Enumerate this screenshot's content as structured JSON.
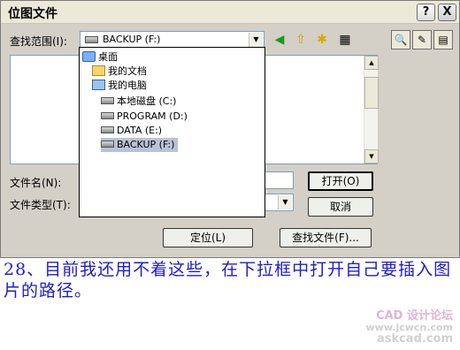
{
  "window": {
    "title": "位图文件",
    "help_btn": "?",
    "close_btn": "X"
  },
  "toolbar": {
    "lookin_label": "查找范围(I):",
    "lookin_value": "BACKUP (F:)",
    "icons": [
      "back-icon",
      "up-folder-icon",
      "new-folder-icon",
      "view-menu-icon",
      "preview-icon",
      "image-option-icon",
      "details-icon"
    ]
  },
  "dropdown": {
    "items": [
      {
        "label": "桌面",
        "icon": "desktop-icon"
      },
      {
        "label": "我的文档",
        "icon": "my-documents-icon"
      },
      {
        "label": "我的电脑",
        "icon": "my-computer-icon"
      },
      {
        "label": "本地磁盘 (C:)",
        "icon": "drive-icon"
      },
      {
        "label": "PROGRAM (D:)",
        "icon": "drive-icon"
      },
      {
        "label": "DATA (E:)",
        "icon": "drive-icon"
      },
      {
        "label": "BACKUP (F:)",
        "icon": "drive-icon",
        "selected": true
      }
    ]
  },
  "form": {
    "filename_label": "文件名(N):",
    "filename_value": "",
    "filetype_label": "文件类型(T):",
    "filetype_value": ""
  },
  "buttons": {
    "open": "打开(O)",
    "cancel": "取消",
    "locate": "定位(L)",
    "find": "查找文件(F)..."
  },
  "caption": "28、目前我还用不着这些，在下拉框中打开自己要插入图片的路径。",
  "watermark": {
    "line1": "CAD 设计论坛",
    "line2": "www.jcwcn.com",
    "line3": "askcad.com"
  },
  "colors": {
    "caption": "#1e1cd0",
    "dialog_bg": "#d4d0c8",
    "selected_item": "#b9c3d6"
  }
}
